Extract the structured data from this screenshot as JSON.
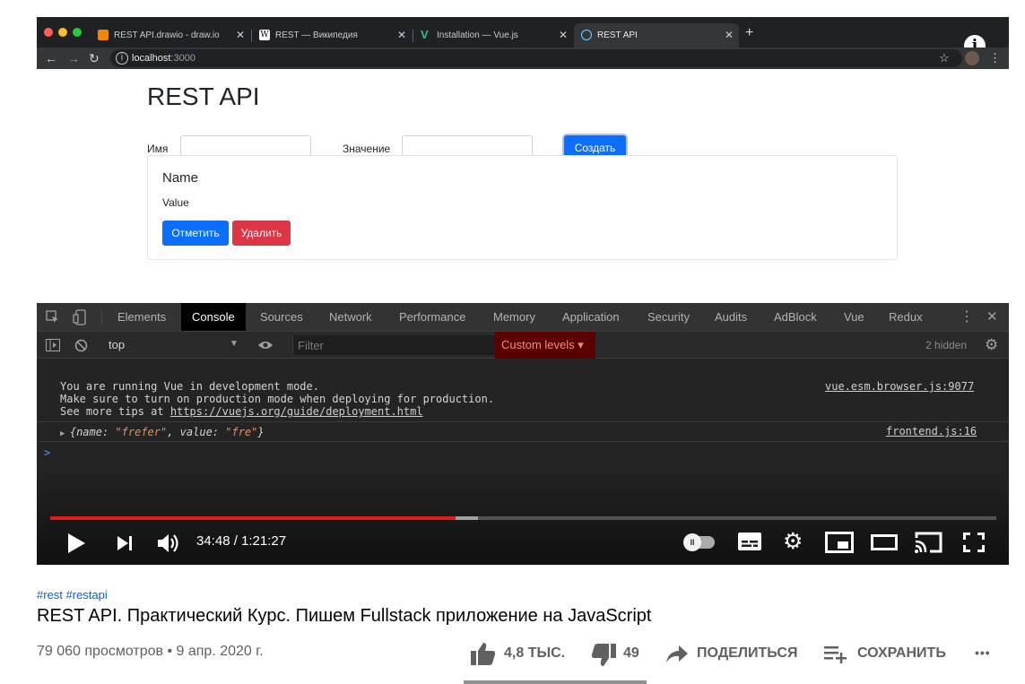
{
  "browser": {
    "tabs": [
      {
        "label": "REST API.drawio - draw.io",
        "favicon_color": "#f08705"
      },
      {
        "label": "REST — Википедия",
        "favicon_color": "#ffffff"
      },
      {
        "label": "Installation — Vue.js",
        "favicon_color": "#41b883"
      },
      {
        "label": "REST API",
        "favicon_color": "#61dafb"
      }
    ],
    "new_tab": "+",
    "url_host": "localhost",
    "url_port": ":3000"
  },
  "app": {
    "title": "REST API",
    "name_label": "Имя",
    "value_label": "Значение",
    "create_button": "Создать",
    "card": {
      "name": "Name",
      "value": "Value",
      "mark_button": "Отметить",
      "delete_button": "Удалить"
    }
  },
  "devtools": {
    "tabs": [
      "Elements",
      "Console",
      "Sources",
      "Network",
      "Performance",
      "Memory",
      "Application",
      "Security",
      "Audits",
      "AdBlock",
      "Vue",
      "Redux"
    ],
    "active_tab": "Console",
    "context": "top",
    "filter_placeholder": "Filter",
    "levels": "Custom levels ▾",
    "hidden": "2 hidden",
    "messages": [
      {
        "line1": "You are running Vue in development mode.",
        "line2": "Make sure to turn on production mode when deploying for production.",
        "line3_prefix": "See more tips at ",
        "line3_link": "https://vuejs.org/guide/deployment.html",
        "source": "vue.esm.browser.js:9077"
      },
      {
        "obj_open": "{name: ",
        "name_val": "\"frefer\"",
        "mid": ", value: ",
        "value_val": "\"fre\"",
        "obj_close": "}",
        "source": "frontend.js:16"
      }
    ],
    "prompt": ">"
  },
  "player": {
    "time": "34:48 / 1:21:27",
    "played_fraction": 0.428,
    "buffered_fraction": 0.452,
    "accent": "#e21b1b"
  },
  "video": {
    "hashtags": "#rest #restapi",
    "title": "REST API. Практический Курс. Пишем Fullstack приложение на JavaScript",
    "views": "79 060 просмотров • 9 апр. 2020 г.",
    "likes": "4,8 ТЫС.",
    "dislikes": "49",
    "share": "ПОДЕЛИТЬСЯ",
    "save": "СОХРАНИТЬ",
    "more": "•••",
    "info": "i"
  }
}
